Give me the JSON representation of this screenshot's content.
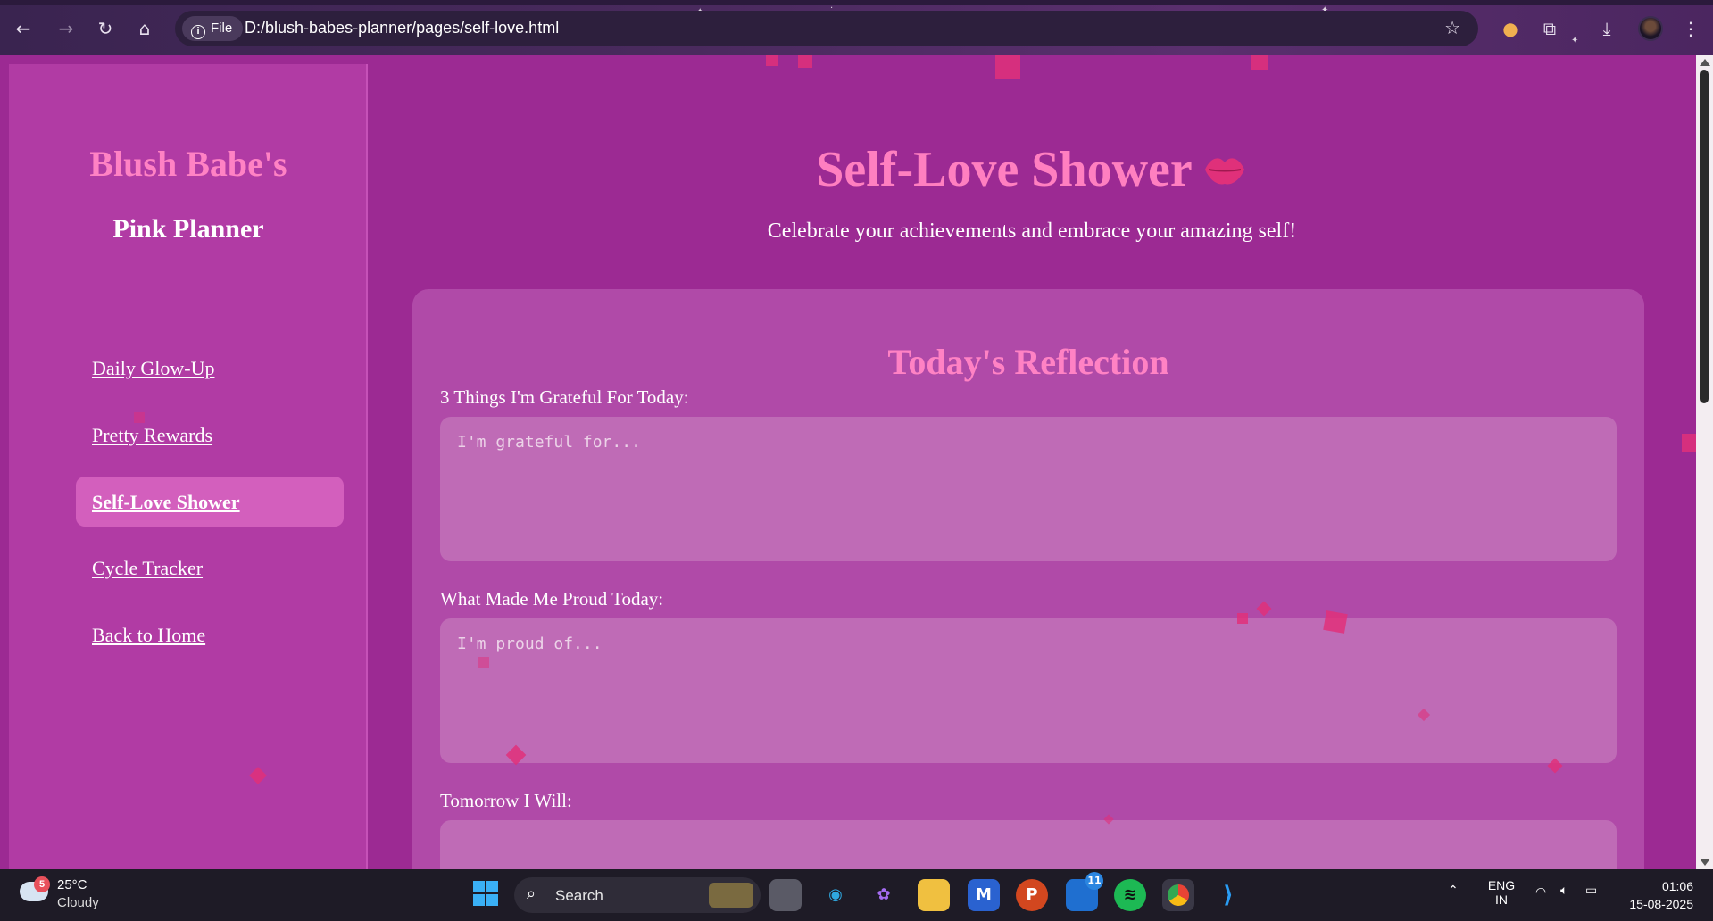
{
  "browser": {
    "file_chip": "File",
    "url": "D:/blush-babes-planner/pages/self-love.html"
  },
  "sidebar": {
    "brand_line1": "Blush Babe's",
    "brand_line2": "Pink Planner",
    "items": [
      {
        "label": "Daily Glow-Up",
        "active": false
      },
      {
        "label": "Pretty Rewards",
        "active": false
      },
      {
        "label": "Self-Love Shower",
        "active": true
      },
      {
        "label": "Cycle Tracker",
        "active": false
      },
      {
        "label": "Back to Home",
        "active": false
      }
    ]
  },
  "main": {
    "title": "Self-Love Shower",
    "subtitle": "Celebrate your achievements and embrace your amazing self!",
    "card_title": "Today's Reflection",
    "fields": [
      {
        "label": "3 Things I'm Grateful For Today:",
        "placeholder": "I'm grateful for..."
      },
      {
        "label": "What Made Me Proud Today:",
        "placeholder": "I'm proud of..."
      },
      {
        "label": "Tomorrow I Will:",
        "placeholder": ""
      }
    ]
  },
  "taskbar": {
    "weather_temp": "25°C",
    "weather_desc": "Cloudy",
    "weather_badge": "5",
    "search_label": "Search",
    "teams_badge": "11",
    "lang_line1": "ENG",
    "lang_line2": "IN",
    "time": "01:06",
    "date": "15-08-2025"
  },
  "colors": {
    "page_bg": "#9c2a93",
    "sidebar_bg": "#b13ba4",
    "accent_pink": "#ff7fc0",
    "card_bg": "#b04aa8",
    "field_bg": "#bf6bb6"
  }
}
